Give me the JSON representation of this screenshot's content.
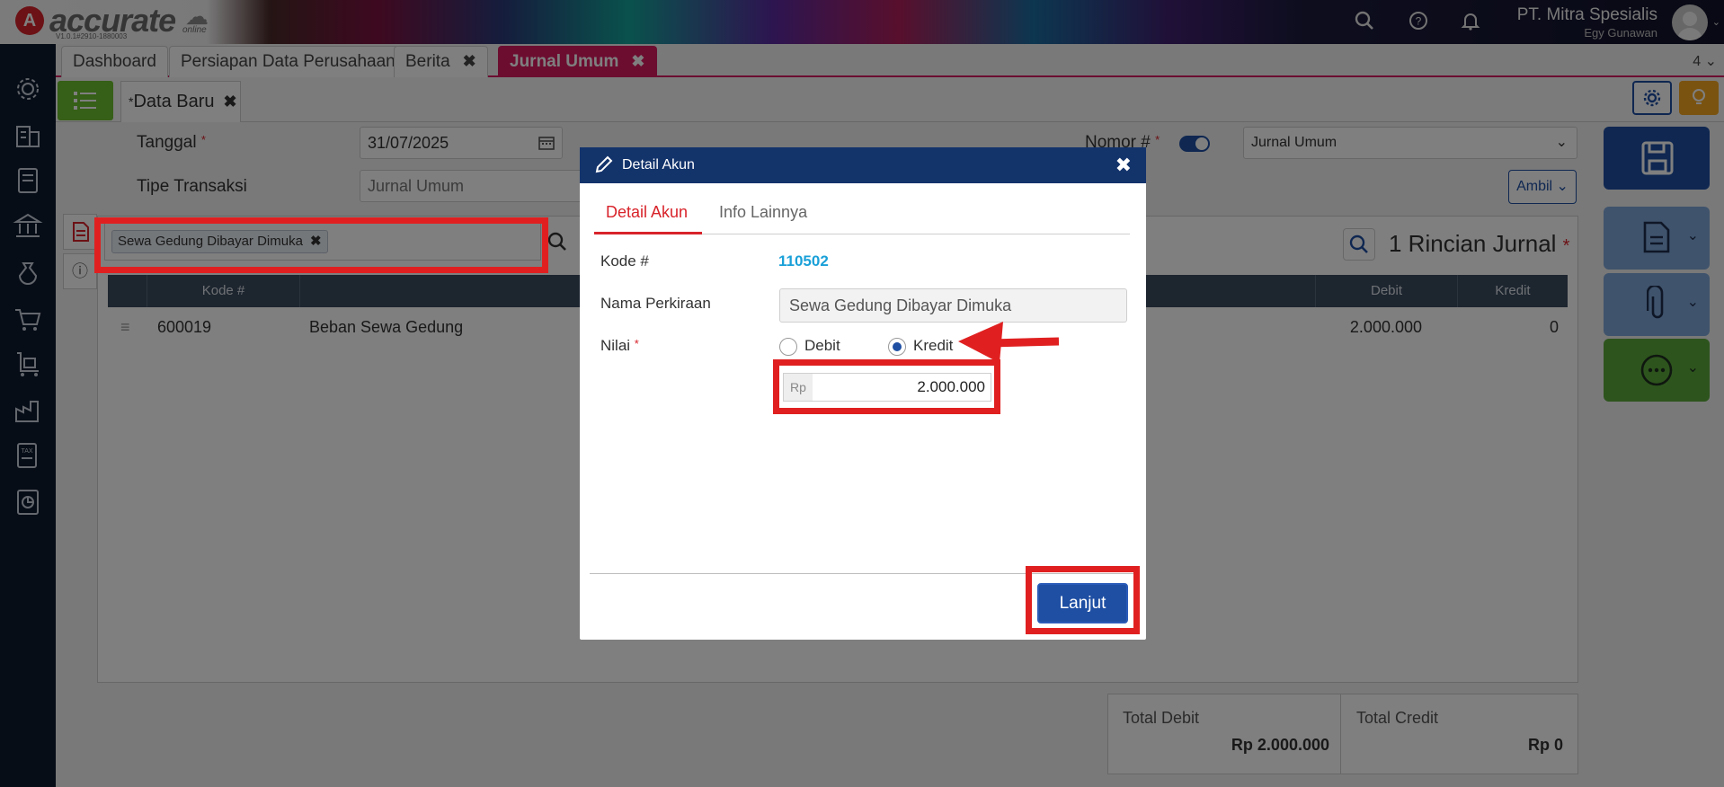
{
  "app": {
    "logo_text": "accurate",
    "logo_sub": "online",
    "version": "V1.0.1#2910-1880003",
    "company_name": "PT. Mitra Spesialis",
    "user_name": "Egy Gunawan"
  },
  "tabs": [
    {
      "label": "Dashboard"
    },
    {
      "label": "Persiapan Data Perusahaan"
    },
    {
      "label": "Berita"
    },
    {
      "label": "Jurnal Umum"
    }
  ],
  "tab_count": "4",
  "subtab": {
    "label": "Data Baru",
    "marker": "*"
  },
  "form": {
    "tanggal_label": "Tanggal",
    "tanggal_value": "31/07/2025",
    "tipe_label": "Tipe Transaksi",
    "tipe_value": "Jurnal Umum",
    "nomor_label": "Nomor #",
    "nomor_select": "Jurnal Umum",
    "ambil_label": "Ambil"
  },
  "detail": {
    "chip_text": "Sewa Gedung Dibayar Dimuka",
    "rincian_title": "1 Rincian Jurnal",
    "columns": [
      "Kode #",
      "Debit",
      "Kredit"
    ],
    "row": {
      "kode": "600019",
      "nama": "Beban Sewa Gedung",
      "debit": "2.000.000",
      "kredit": "0"
    }
  },
  "totals": {
    "debit_label": "Total Debit",
    "debit_value": "Rp 2.000.000",
    "credit_label": "Total Credit",
    "credit_value": "Rp 0"
  },
  "modal": {
    "title": "Detail Akun",
    "tabs": [
      "Detail Akun",
      "Info Lainnya"
    ],
    "kode_label": "Kode #",
    "kode_value": "110502",
    "nama_label": "Nama Perkiraan",
    "nama_value": "Sewa Gedung Dibayar Dimuka",
    "nilai_label": "Nilai",
    "debit_option": "Debit",
    "kredit_option": "Kredit",
    "selected_option": "Kredit",
    "currency": "Rp",
    "amount": "2.000.000",
    "submit_label": "Lanjut"
  },
  "colors": {
    "brand_red": "#d8232a",
    "tab_active": "#d81b60",
    "primary_blue": "#1f4fa3",
    "sidebar_bg": "#0e1a2e",
    "highlight": "#e02020"
  }
}
